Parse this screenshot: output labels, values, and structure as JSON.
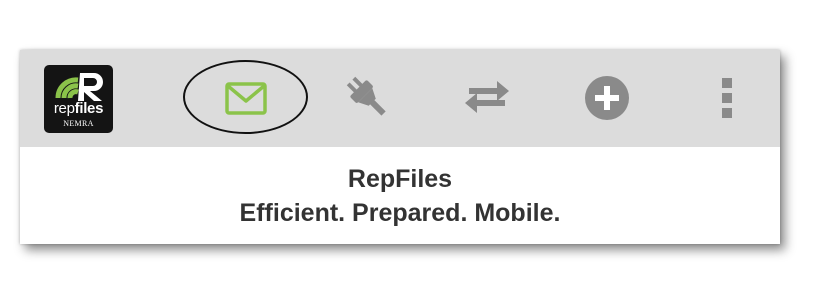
{
  "logo": {
    "brand_prefix": "rep",
    "brand_suffix": "files",
    "company": "NEMRA"
  },
  "toolbar": {
    "items": [
      {
        "icon": "mail-icon",
        "color": "#8bc34a",
        "selected": true
      },
      {
        "icon": "plug-icon",
        "color": "#8a8a8a"
      },
      {
        "icon": "sync-arrows-icon",
        "color": "#8a8a8a"
      },
      {
        "icon": "add-circle-icon",
        "color": "#8a8a8a"
      },
      {
        "icon": "more-vertical-icon",
        "color": "#8a8a8a"
      }
    ]
  },
  "main": {
    "title": "RepFiles",
    "tagline": "Efficient. Prepared. Mobile."
  },
  "colors": {
    "toolbar_bg": "#dcdcdc",
    "accent_green": "#8bc34a",
    "icon_gray": "#8a8a8a",
    "text_dark": "#333333"
  }
}
